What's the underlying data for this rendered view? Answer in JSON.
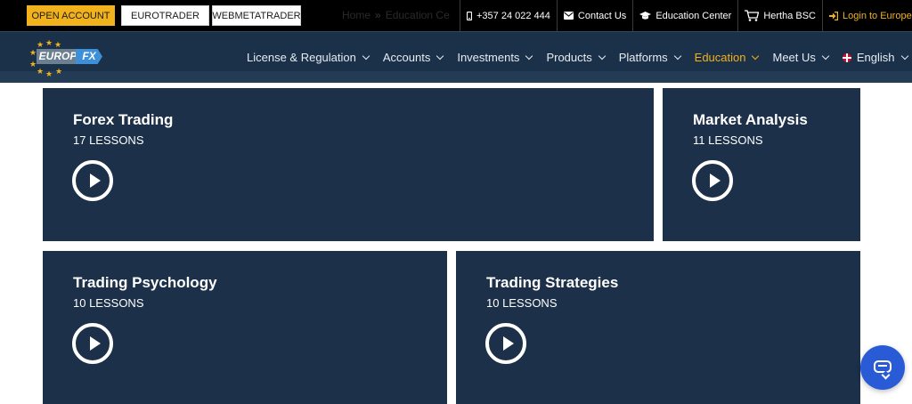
{
  "topbar": {
    "buttons": [
      {
        "label": "OPEN ACCOUNT"
      },
      {
        "label": "EUROTRADER"
      },
      {
        "label": "WEBMETATRADER"
      }
    ],
    "breadcrumb": {
      "home": "Home",
      "separator": "»",
      "current": "Education Ce"
    },
    "links": [
      {
        "label": "+357 24 022 444",
        "icon": "phone-icon"
      },
      {
        "label": "Contact Us",
        "icon": "envelope-icon"
      },
      {
        "label": "Education Center",
        "icon": "graduation-cap-icon"
      },
      {
        "label": "Hertha BSC",
        "icon": "shopping-cart-icon"
      },
      {
        "label": "Login to EuropeFX",
        "icon": "login-icon"
      }
    ]
  },
  "logo": {
    "part1": "EUROPE",
    "part2": "FX"
  },
  "nav": {
    "items": [
      {
        "label": "License & Regulation"
      },
      {
        "label": "Accounts"
      },
      {
        "label": "Investments"
      },
      {
        "label": "Products"
      },
      {
        "label": "Platforms"
      },
      {
        "label": "Education",
        "active": true
      },
      {
        "label": "Meet Us"
      },
      {
        "label": "English"
      }
    ]
  },
  "cards": [
    {
      "title": "Forex Trading",
      "count": "17 LESSONS"
    },
    {
      "title": "Market Analysis",
      "count": "11 LESSONS"
    },
    {
      "title": "Trading Psychology",
      "count": "10 LESSONS"
    },
    {
      "title": "Trading Strategies",
      "count": "10 LESSONS"
    }
  ],
  "colors": {
    "accent": "#f2b21c",
    "navy": "#1c3049",
    "chat": "#2a5bd7"
  }
}
